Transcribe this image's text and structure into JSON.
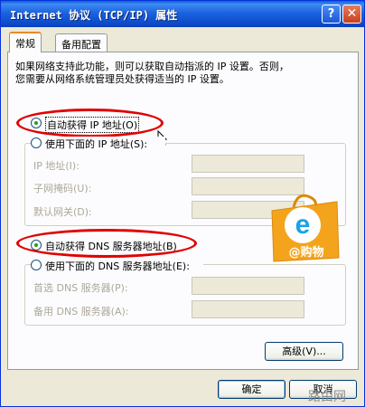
{
  "window": {
    "title": "Internet 协议 (TCP/IP) 属性",
    "help_glyph": "?",
    "close_glyph": "✕"
  },
  "tabs": [
    {
      "label": "常规",
      "selected": true
    },
    {
      "label": "备用配置",
      "selected": false
    }
  ],
  "description": [
    "如果网络支持此功能，则可以获取自动指派的 IP 设置。否则，",
    "您需要从网络系统管理员处获得适当的 IP 设置。"
  ],
  "ip_section": {
    "auto_option": {
      "label": "自动获得 IP 地址(O)",
      "checked": true
    },
    "manual_option": {
      "label": "使用下面的 IP 地址(S):",
      "checked": false
    },
    "fields": [
      {
        "label": "IP 地址(I):",
        "value": ""
      },
      {
        "label": "子网掩码(U):",
        "value": ""
      },
      {
        "label": "默认网关(D):",
        "value": ""
      }
    ]
  },
  "dns_section": {
    "auto_option": {
      "label": "自动获得 DNS 服务器地址(B)",
      "checked": true
    },
    "manual_option": {
      "label": "使用下面的 DNS 服务器地址(E):",
      "checked": false
    },
    "fields": [
      {
        "label": "首选 DNS 服务器(P):",
        "value": ""
      },
      {
        "label": "备用 DNS 服务器(A):",
        "value": ""
      }
    ]
  },
  "buttons": {
    "advanced": "高级(V)...",
    "ok": "确定",
    "cancel": "取消"
  },
  "logo": {
    "letter": "e",
    "text": "@购物",
    "colors": {
      "bag": "#f4a41c",
      "letter": "#1aa2e6"
    }
  },
  "watermark": "路由网",
  "colors": {
    "highlight_ellipse": "#e00000",
    "titlebar": "#0b49c7",
    "dialog_bg": "#ece9d8"
  }
}
